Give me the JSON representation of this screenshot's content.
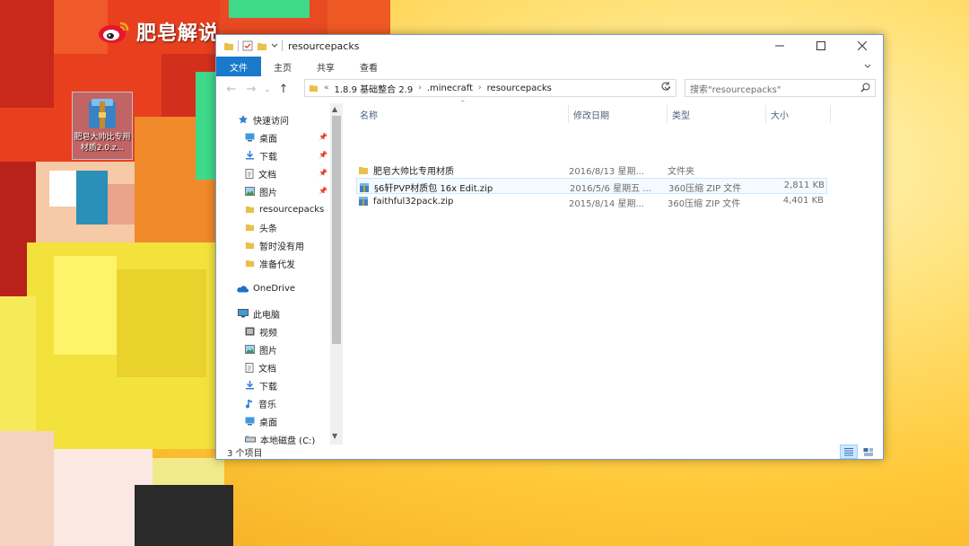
{
  "watermark": {
    "text": "肥皂解说"
  },
  "desktop": {
    "icon_label": "肥皂大帅比专用材质2.0.z..."
  },
  "window": {
    "title": "resourcepacks",
    "ribbon_tabs": [
      {
        "label": "文件",
        "active": true
      },
      {
        "label": "主页",
        "active": false
      },
      {
        "label": "共享",
        "active": false
      },
      {
        "label": "查看",
        "active": false
      }
    ],
    "address": {
      "overflow": "«",
      "crumbs": [
        "1.8.9 基础整合 2.9",
        ".minecraft",
        "resourcepacks"
      ]
    },
    "search": {
      "placeholder": "搜索\"resourcepacks\""
    },
    "nav_pane": {
      "quick_access": "快速访问",
      "quick_items": [
        {
          "label": "桌面",
          "icon": "desktop-icon",
          "pinned": true
        },
        {
          "label": "下载",
          "icon": "download-icon",
          "pinned": true
        },
        {
          "label": "文档",
          "icon": "documents-icon",
          "pinned": true
        },
        {
          "label": "图片",
          "icon": "pictures-icon",
          "pinned": true
        },
        {
          "label": "resourcepacks",
          "icon": "folder-icon",
          "pinned": false
        },
        {
          "label": "头条",
          "icon": "folder-icon",
          "pinned": false
        },
        {
          "label": "暂时没有用",
          "icon": "folder-icon",
          "pinned": false
        },
        {
          "label": "准备代发",
          "icon": "folder-icon",
          "pinned": false
        }
      ],
      "onedrive": "OneDrive",
      "this_pc": "此电脑",
      "pc_items": [
        {
          "label": "视频",
          "icon": "videos-icon"
        },
        {
          "label": "图片",
          "icon": "pictures-icon"
        },
        {
          "label": "文档",
          "icon": "documents-icon"
        },
        {
          "label": "下载",
          "icon": "download-icon"
        },
        {
          "label": "音乐",
          "icon": "music-icon"
        },
        {
          "label": "桌面",
          "icon": "desktop-icon"
        },
        {
          "label": "本地磁盘 (C:)",
          "icon": "drive-icon"
        }
      ]
    },
    "columns": {
      "name": "名称",
      "date": "修改日期",
      "type": "类型",
      "size": "大小"
    },
    "files": [
      {
        "name": "肥皂大帅比专用材质",
        "date": "2016/8/13 星期...",
        "type": "文件夹",
        "size": "",
        "icon": "folder-icon",
        "selected": false
      },
      {
        "name": "§6轩PVP材质包 16x Edit.zip",
        "date": "2016/5/6 星期五 ...",
        "type": "360压缩 ZIP 文件",
        "size": "2,811 KB",
        "icon": "zip-archive-icon",
        "selected": true
      },
      {
        "name": "faithful32pack.zip",
        "date": "2015/8/14 星期...",
        "type": "360压缩 ZIP 文件",
        "size": "4,401 KB",
        "icon": "zip-archive-icon",
        "selected": false
      }
    ],
    "status": "3 个项目"
  },
  "colors": {
    "accent": "#1979ca",
    "selection": "#cce8ff",
    "folder": "#e8c04a"
  }
}
